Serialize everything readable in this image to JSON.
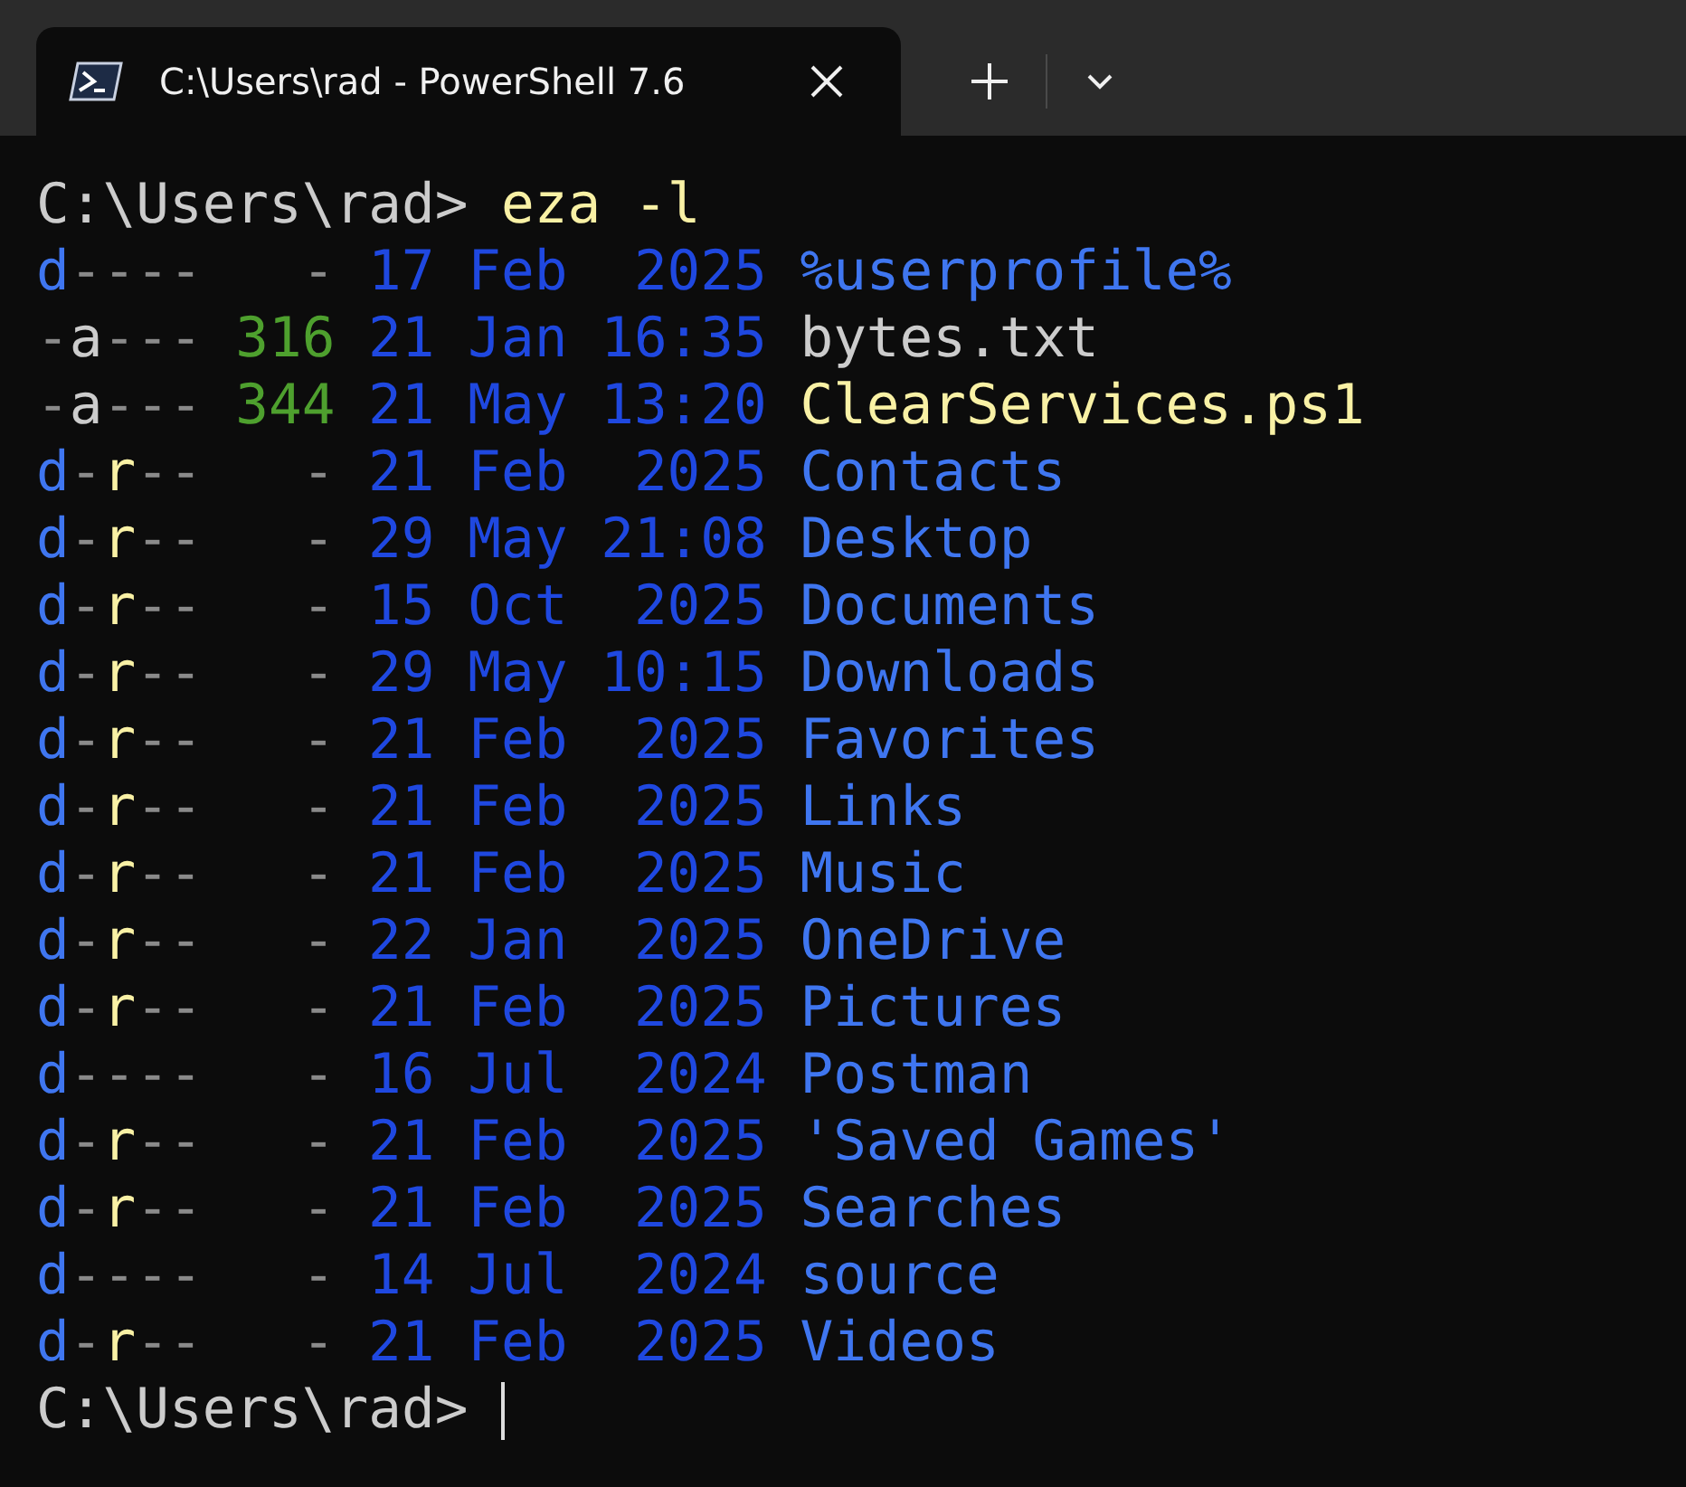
{
  "tab": {
    "title": "C:\\Users\\rad - PowerShell 7.6",
    "selected": true
  },
  "command_line": {
    "prompt": "C:\\Users\\rad>",
    "command": "eza -l"
  },
  "rows": [
    {
      "kind": "dir",
      "perms": "d----",
      "size": "-",
      "date": "17 Feb  2025",
      "name": "%userprofile%"
    },
    {
      "kind": "file",
      "perms": "-a---",
      "size": "316",
      "date": "21 Jan 16:35",
      "name": "bytes.txt"
    },
    {
      "kind": "script",
      "perms": "-a---",
      "size": "344",
      "date": "21 May 13:20",
      "name": "ClearServices.ps1"
    },
    {
      "kind": "dir",
      "perms": "d-r--",
      "size": "-",
      "date": "21 Feb  2025",
      "name": "Contacts"
    },
    {
      "kind": "dir",
      "perms": "d-r--",
      "size": "-",
      "date": "29 May 21:08",
      "name": "Desktop"
    },
    {
      "kind": "dir",
      "perms": "d-r--",
      "size": "-",
      "date": "15 Oct  2025",
      "name": "Documents"
    },
    {
      "kind": "dir",
      "perms": "d-r--",
      "size": "-",
      "date": "29 May 10:15",
      "name": "Downloads"
    },
    {
      "kind": "dir",
      "perms": "d-r--",
      "size": "-",
      "date": "21 Feb  2025",
      "name": "Favorites"
    },
    {
      "kind": "dir",
      "perms": "d-r--",
      "size": "-",
      "date": "21 Feb  2025",
      "name": "Links"
    },
    {
      "kind": "dir",
      "perms": "d-r--",
      "size": "-",
      "date": "21 Feb  2025",
      "name": "Music"
    },
    {
      "kind": "dir",
      "perms": "d-r--",
      "size": "-",
      "date": "22 Jan  2025",
      "name": "OneDrive"
    },
    {
      "kind": "dir",
      "perms": "d-r--",
      "size": "-",
      "date": "21 Feb  2025",
      "name": "Pictures"
    },
    {
      "kind": "dir",
      "perms": "d----",
      "size": "-",
      "date": "16 Jul  2024",
      "name": "Postman"
    },
    {
      "kind": "dir",
      "perms": "d-r--",
      "size": "-",
      "date": "21 Feb  2025",
      "name": "'Saved Games'"
    },
    {
      "kind": "dir",
      "perms": "d-r--",
      "size": "-",
      "date": "21 Feb  2025",
      "name": "Searches"
    },
    {
      "kind": "dir",
      "perms": "d----",
      "size": "-",
      "date": "14 Jul  2024",
      "name": "source"
    },
    {
      "kind": "dir",
      "perms": "d-r--",
      "size": "-",
      "date": "21 Feb  2025",
      "name": "Videos"
    }
  ],
  "final_prompt": "C:\\Users\\rad>"
}
